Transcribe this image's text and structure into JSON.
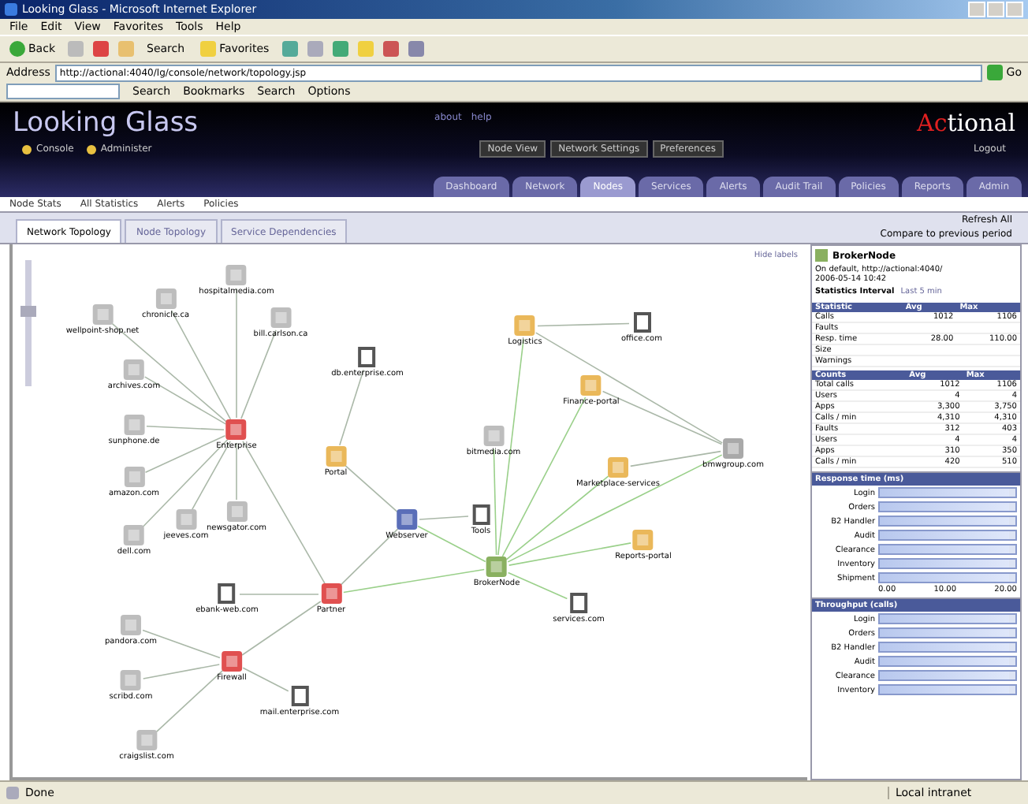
{
  "window": {
    "title": "Looking Glass - Microsoft Internet Explorer"
  },
  "menu": [
    "File",
    "Edit",
    "View",
    "Favorites",
    "Tools",
    "Help"
  ],
  "toolbar": {
    "back": "Back",
    "search": "Search",
    "favorites": "Favorites"
  },
  "address": {
    "label": "Address",
    "value": "http://actional:4040/lg/console/network/topology.jsp",
    "go": "Go"
  },
  "links_bar": {
    "search_button": "Search",
    "bookmarks": "Bookmarks",
    "dropdown": "Search",
    "options": "Options"
  },
  "app": {
    "title": "Looking Glass",
    "logo_accent": "Ac",
    "logo_rest": "tional",
    "top_links": [
      "about",
      "help"
    ],
    "user_links": [
      "Console",
      "Administer"
    ],
    "buttons": [
      "Node View",
      "Network Settings",
      "Preferences"
    ],
    "logout": "Logout",
    "tabs": [
      {
        "label": "Dashboard",
        "selected": false
      },
      {
        "label": "Network",
        "selected": false
      },
      {
        "label": "Nodes",
        "selected": true
      },
      {
        "label": "Services",
        "selected": false
      },
      {
        "label": "Alerts",
        "selected": false
      },
      {
        "label": "Audit Trail",
        "selected": false
      },
      {
        "label": "Policies",
        "selected": false
      },
      {
        "label": "Reports",
        "selected": false
      },
      {
        "label": "Admin",
        "selected": false
      }
    ],
    "subnav": [
      "Node Stats",
      "All Statistics",
      "Alerts",
      "Policies"
    ]
  },
  "view_tabs": [
    {
      "label": "Network Topology",
      "selected": true
    },
    {
      "label": "Node Topology",
      "selected": false
    },
    {
      "label": "Service Dependencies",
      "selected": false
    }
  ],
  "view_right": {
    "refresh": "Refresh All",
    "history": "Compare to previous period"
  },
  "graph": {
    "zoom": {
      "level": 0.45
    },
    "hide_labels": "Hide labels",
    "nodes": [
      {
        "label": "hospitalmedia.com",
        "color": "#bdbdbd",
        "kind": "box"
      },
      {
        "label": "chronicle.ca",
        "color": "#bdbdbd",
        "kind": "box"
      },
      {
        "label": "wellpoint-shop.net",
        "color": "#bdbdbd",
        "kind": "box"
      },
      {
        "label": "bill.carlson.ca",
        "color": "#bdbdbd",
        "kind": "box"
      },
      {
        "label": "archives.com",
        "color": "#bdbdbd",
        "kind": "box"
      },
      {
        "label": "sunphone.de",
        "color": "#bdbdbd",
        "kind": "box"
      },
      {
        "label": "amazon.com",
        "color": "#bdbdbd",
        "kind": "box"
      },
      {
        "label": "dell.com",
        "color": "#bdbdbd",
        "kind": "box"
      },
      {
        "label": "jeeves.com",
        "color": "#bdbdbd",
        "kind": "box"
      },
      {
        "label": "newsgator.com",
        "color": "#bdbdbd",
        "kind": "box"
      },
      {
        "label": "bitmedia.com",
        "color": "#bdbdbd",
        "kind": "box"
      },
      {
        "label": "pandora.com",
        "color": "#bdbdbd",
        "kind": "box"
      },
      {
        "label": "scribd.com",
        "color": "#bdbdbd",
        "kind": "box"
      },
      {
        "label": "craigslist.com",
        "color": "#bdbdbd",
        "kind": "box"
      },
      {
        "label": "bmwgroup.com",
        "color": "#a9a9a9",
        "kind": "box"
      },
      {
        "label": "Enterprise",
        "color": "#e05050",
        "kind": "box"
      },
      {
        "label": "Partner",
        "color": "#e05050",
        "kind": "box"
      },
      {
        "label": "Firewall",
        "color": "#e05050",
        "kind": "box"
      },
      {
        "label": "db.enterprise.com",
        "color": "#555555",
        "kind": "server"
      },
      {
        "label": "ebank-web.com",
        "color": "#555555",
        "kind": "server"
      },
      {
        "label": "Tools",
        "color": "#555555",
        "kind": "server"
      },
      {
        "label": "mail.enterprise.com",
        "color": "#555555",
        "kind": "server"
      },
      {
        "label": "office.com",
        "color": "#555555",
        "kind": "server"
      },
      {
        "label": "services.com",
        "color": "#555555",
        "kind": "server"
      },
      {
        "label": "Portal",
        "color": "#eab85a",
        "kind": "box"
      },
      {
        "label": "Logistics",
        "color": "#eab85a",
        "kind": "box"
      },
      {
        "label": "Finance-portal",
        "color": "#eab85a",
        "kind": "box"
      },
      {
        "label": "Marketplace-services",
        "color": "#eab85a",
        "kind": "box"
      },
      {
        "label": "Reports-portal",
        "color": "#eab85a",
        "kind": "box"
      },
      {
        "label": "Webserver",
        "color": "#5a6eb8",
        "kind": "box"
      },
      {
        "label": "BrokerNode",
        "color": "#8ab060",
        "kind": "box"
      }
    ]
  },
  "panel": {
    "node": "BrokerNode",
    "lines": [
      "On default, http://actional:4040/",
      "2006-05-14 10:42"
    ],
    "interval_label": "Statistics Interval",
    "interval_value": "Last 5 min",
    "tables": [
      {
        "columns": [
          "Statistic",
          "Avg",
          "Max"
        ],
        "rows": [
          [
            "Calls",
            "1012",
            "1106"
          ],
          [
            "Faults",
            "",
            ""
          ],
          [
            "Resp. time",
            "28.00",
            "110.00"
          ],
          [
            "Size",
            "",
            ""
          ],
          [
            "Warnings",
            "",
            ""
          ]
        ]
      },
      {
        "columns": [
          "Counts",
          "Avg",
          "Max"
        ],
        "rows": [
          [
            "Total calls",
            "1012",
            "1106"
          ],
          [
            "Users",
            "4",
            "4"
          ],
          [
            "Apps",
            "3,300",
            "3,750"
          ],
          [
            "Calls / min",
            "4,310",
            "4,310"
          ],
          [
            "Faults",
            "312",
            "403"
          ],
          [
            "Users",
            "4",
            "4"
          ],
          [
            "Apps",
            "310",
            "350"
          ],
          [
            "Calls / min",
            "420",
            "510"
          ]
        ]
      }
    ],
    "charts": [
      {
        "title": "Response time (ms)",
        "axis": [
          "0.00",
          "10.00",
          "20.00"
        ],
        "bars": [
          {
            "label": "Login",
            "level": 0.95
          },
          {
            "label": "Orders",
            "level": 0.95
          },
          {
            "label": "B2 Handler",
            "level": 0.95
          },
          {
            "label": "Audit",
            "level": 0.95
          },
          {
            "label": "Clearance",
            "level": 0.95
          },
          {
            "label": "Inventory",
            "level": 0.95
          },
          {
            "label": "Shipment",
            "level": 0.95
          }
        ]
      },
      {
        "title": "Throughput (calls)",
        "bars": [
          {
            "label": "Login",
            "level": 0.95
          },
          {
            "label": "Orders",
            "level": 0.95
          },
          {
            "label": "B2 Handler",
            "level": 0.95
          },
          {
            "label": "Audit",
            "level": 0.95
          },
          {
            "label": "Clearance",
            "level": 0.95
          },
          {
            "label": "Inventory",
            "level": 0.95
          }
        ]
      }
    ]
  },
  "status_bar": {
    "text": "Done",
    "zone": "Local intranet"
  }
}
